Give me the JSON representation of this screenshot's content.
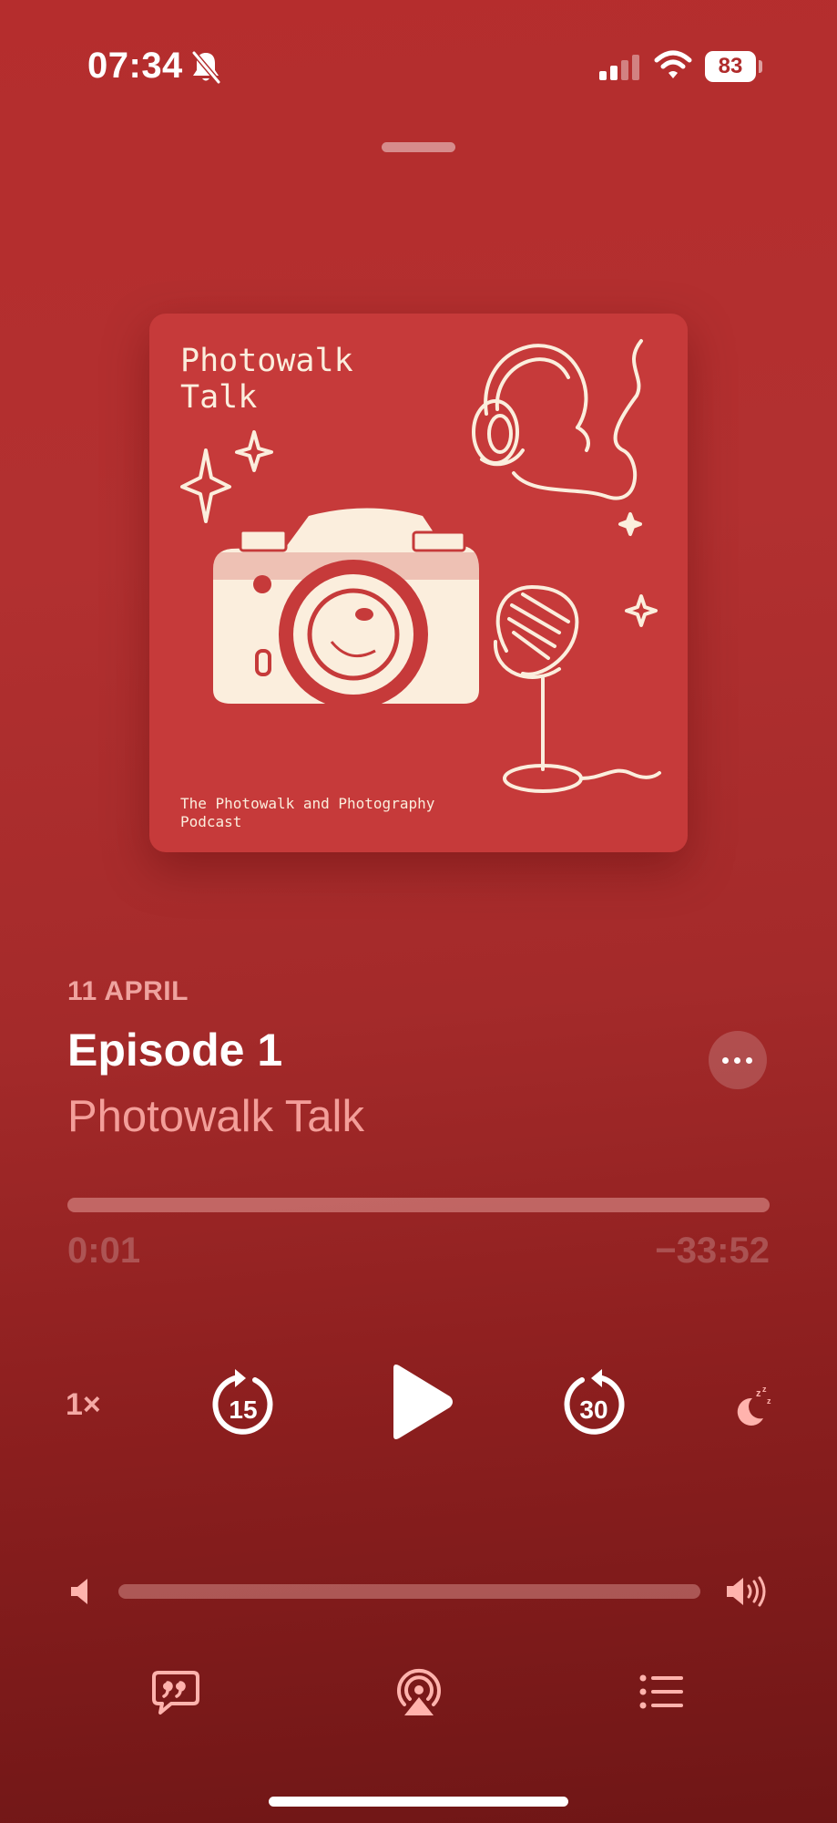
{
  "status_bar": {
    "time": "07:34",
    "battery": "83"
  },
  "artwork": {
    "title_line1": "Photowalk",
    "title_line2": "Talk",
    "subtitle_line1": "The Photowalk and Photography",
    "subtitle_line2": "Podcast"
  },
  "episode": {
    "date": "11 APRIL",
    "title": "Episode 1",
    "show": "Photowalk Talk"
  },
  "playback": {
    "elapsed": "0:01",
    "remaining": "−33:52",
    "progress": 0.0005,
    "speed": "1×",
    "skip_back": "15",
    "skip_forward": "30",
    "volume": 1.0
  },
  "icons": [
    "bell-slash-icon",
    "cellular-signal-icon",
    "wifi-icon",
    "more-icon",
    "skip-back-15-icon",
    "play-icon",
    "skip-forward-30-icon",
    "sleep-timer-icon",
    "volume-low-icon",
    "volume-high-icon",
    "lyrics-quote-icon",
    "airplay-icon",
    "queue-list-icon"
  ],
  "colors": {
    "background": "#b02e2e",
    "accent_pink": "#ffb3ad",
    "artwork_bg": "#c63a3a",
    "artwork_ink": "#fbeedd"
  }
}
